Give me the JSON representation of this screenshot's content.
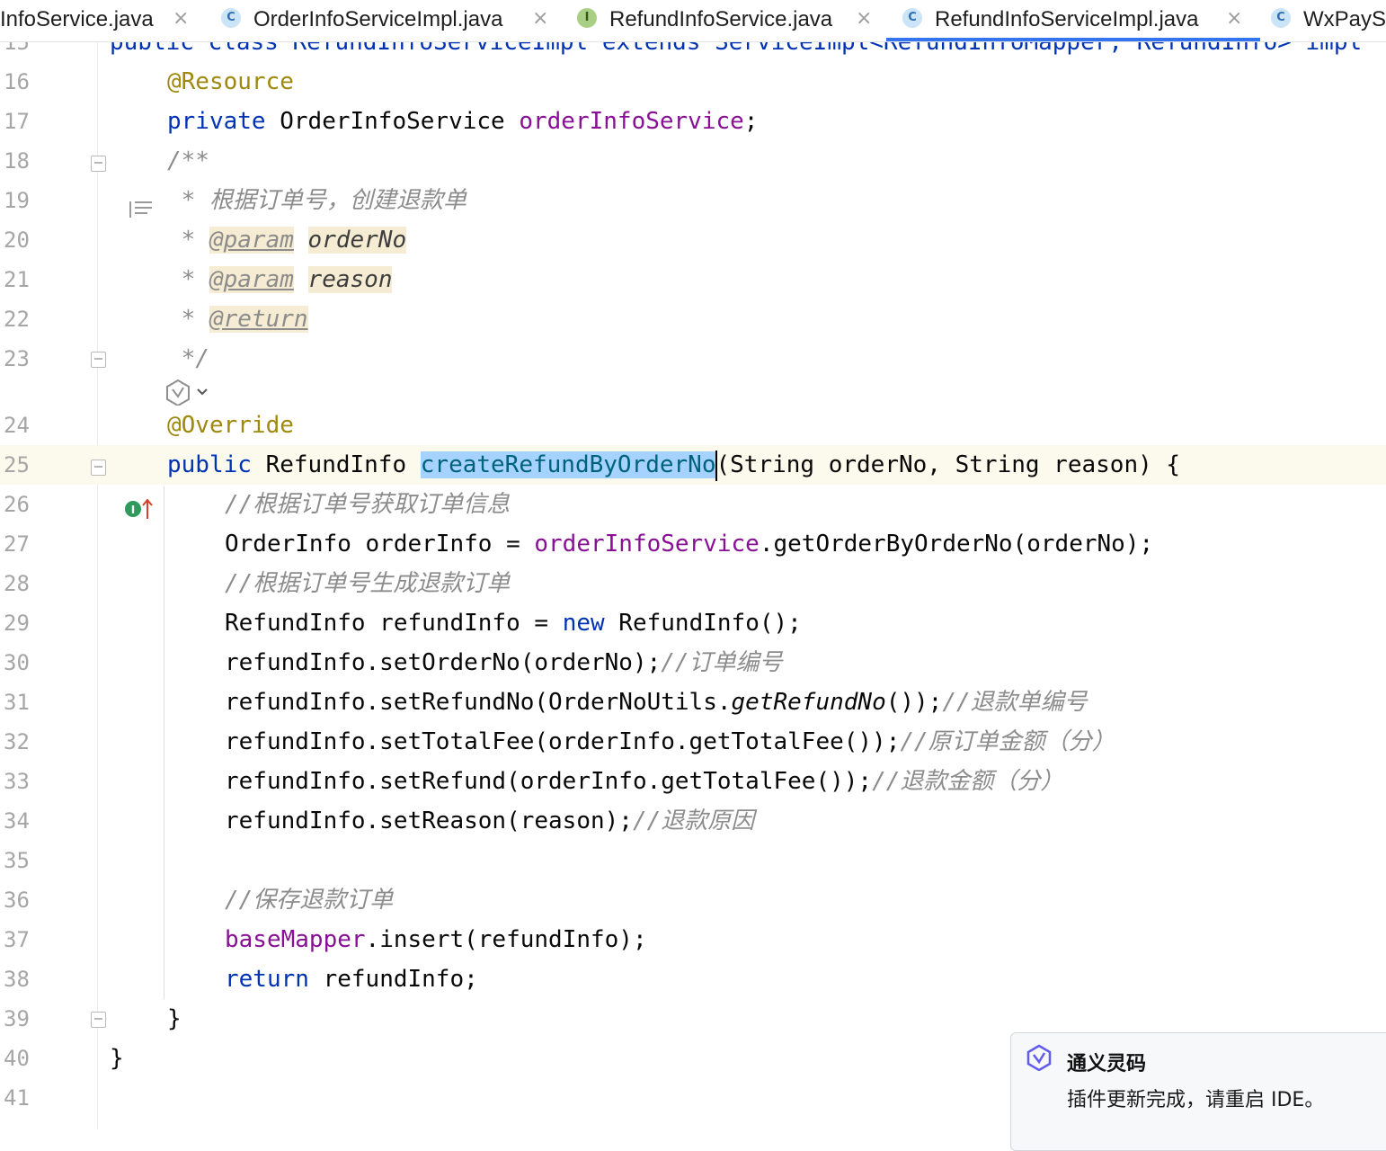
{
  "tabs": [
    {
      "label": "InfoService.java",
      "icon": "none",
      "active": false
    },
    {
      "label": "OrderInfoServiceImpl.java",
      "icon": "C",
      "active": false
    },
    {
      "label": "RefundInfoService.java",
      "icon": "I",
      "active": false
    },
    {
      "label": "RefundInfoServiceImpl.java",
      "icon": "C",
      "active": true
    },
    {
      "label": "WxPayS",
      "icon": "C",
      "active": false
    }
  ],
  "tab_close_glyph": "×",
  "lines": {
    "l15": {
      "num": "15",
      "code": "public class RefundInfoServiceImpl extends ServiceImpl<RefundInfoMapper, RefundInfo> impl"
    },
    "l16": {
      "num": "16",
      "ann": "@Resource"
    },
    "l17": {
      "num": "17",
      "kw": "private",
      "type": " OrderInfoService ",
      "field": "orderInfoService",
      "end": ";"
    },
    "l18": {
      "num": "18",
      "cmt": "/**"
    },
    "l19": {
      "num": "19",
      "star": " * ",
      "cmt": "根据订单号，创建退款单"
    },
    "l20": {
      "num": "20",
      "star": " * ",
      "tag": "@param",
      "param": "orderNo"
    },
    "l21": {
      "num": "21",
      "star": " * ",
      "tag": "@param",
      "param": "reason"
    },
    "l22": {
      "num": "22",
      "star": " * ",
      "tag": "@return"
    },
    "l23": {
      "num": "23",
      "cmt": " */"
    },
    "l24": {
      "num": "24",
      "ann": "@Override"
    },
    "l25": {
      "num": "25",
      "kw": "public",
      "type": " RefundInfo ",
      "method": "createRefundByOrderNo",
      "rest": "(String orderNo, String reason) {"
    },
    "l26": {
      "num": "26",
      "cmt": "//根据订单号获取订单信息"
    },
    "l27": {
      "num": "27",
      "a": "OrderInfo orderInfo = ",
      "field": "orderInfoService",
      "b": ".getOrderByOrderNo(orderNo);"
    },
    "l28": {
      "num": "28",
      "cmt": "//根据订单号生成退款订单"
    },
    "l29": {
      "num": "29",
      "a": "RefundInfo refundInfo = ",
      "kw": "new",
      "b": " RefundInfo();"
    },
    "l30": {
      "num": "30",
      "a": "refundInfo.setOrderNo(orderNo);",
      "cmt": "//订单编号"
    },
    "l31": {
      "num": "31",
      "a": "refundInfo.setRefundNo(OrderNoUtils.",
      "static": "getRefundNo",
      "b": "());",
      "cmt": "//退款单编号"
    },
    "l32": {
      "num": "32",
      "a": "refundInfo.setTotalFee(orderInfo.getTotalFee());",
      "cmt": "//原订单金额（分）"
    },
    "l33": {
      "num": "33",
      "a": "refundInfo.setRefund(orderInfo.getTotalFee());",
      "cmt": "//退款金额（分）"
    },
    "l34": {
      "num": "34",
      "a": "refundInfo.setReason(reason);",
      "cmt": "//退款原因"
    },
    "l35": {
      "num": "35"
    },
    "l36": {
      "num": "36",
      "cmt": "//保存退款订单"
    },
    "l37": {
      "num": "37",
      "field": "baseMapper",
      "a": ".insert(refundInfo);"
    },
    "l38": {
      "num": "38",
      "kw": "return",
      "a": " refundInfo;"
    },
    "l39": {
      "num": "39",
      "a": "}"
    },
    "l40": {
      "num": "40",
      "a": "}"
    },
    "l41": {
      "num": "41"
    }
  },
  "gutter_marks": {
    "implement_badge": "I"
  },
  "notification": {
    "title": "通义灵码",
    "body": "插件更新完成，请重启 IDE。"
  },
  "colors": {
    "keyword": "#0033b3",
    "annotation": "#9e880d",
    "field": "#871094",
    "comment": "#8c8c8c",
    "method": "#00627a",
    "selection": "#a6d2ff",
    "current_line": "#fcfaed",
    "active_tab_underline": "#3574f0"
  }
}
